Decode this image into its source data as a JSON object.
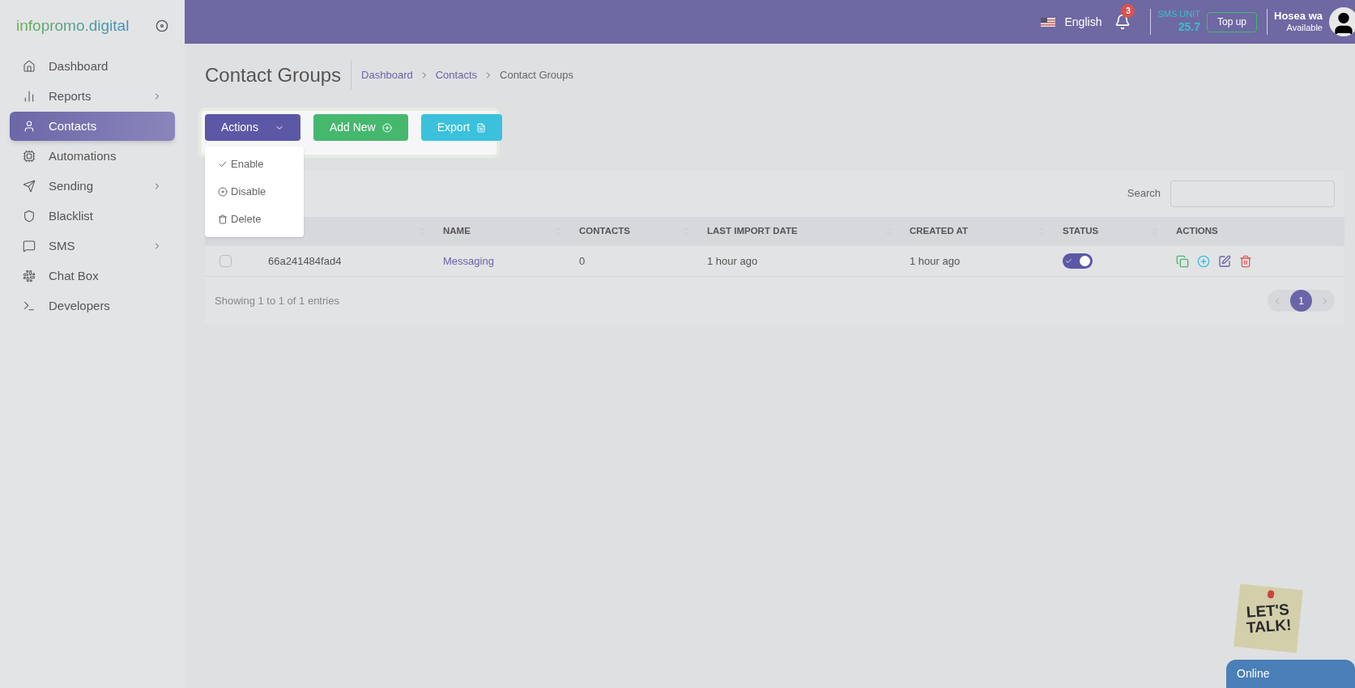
{
  "sidebar": {
    "logo": "infopromo.digital",
    "items": [
      {
        "label": "Dashboard",
        "has_submenu": false,
        "selected": false
      },
      {
        "label": "Reports",
        "has_submenu": true,
        "selected": false
      },
      {
        "label": "Contacts",
        "has_submenu": false,
        "selected": true
      },
      {
        "label": "Automations",
        "has_submenu": false,
        "selected": false
      },
      {
        "label": "Sending",
        "has_submenu": true,
        "selected": false
      },
      {
        "label": "Blacklist",
        "has_submenu": false,
        "selected": false
      },
      {
        "label": "SMS",
        "has_submenu": true,
        "selected": false
      },
      {
        "label": "Chat Box",
        "has_submenu": false,
        "selected": false
      },
      {
        "label": "Developers",
        "has_submenu": false,
        "selected": false
      }
    ]
  },
  "topbar": {
    "language": "English",
    "notification_count": "3",
    "sms_unit_label": "SMS UNIT",
    "sms_unit_value": "25.7",
    "topup": "Top up",
    "user_name": "Hosea wa",
    "user_status": "Available"
  },
  "page": {
    "title": "Contact Groups",
    "breadcrumb": [
      {
        "label": "Dashboard",
        "kind": "link"
      },
      {
        "label": "Contacts",
        "kind": "link"
      },
      {
        "label": "Contact Groups",
        "kind": "current"
      }
    ]
  },
  "toolbar": {
    "buttons": [
      {
        "label": "Actions",
        "kind": "actions"
      },
      {
        "label": "Add New",
        "kind": "add"
      },
      {
        "label": "Export",
        "kind": "export"
      }
    ],
    "dropdown": [
      {
        "label": "Enable",
        "kind": "enable"
      },
      {
        "label": "Disable",
        "kind": "disable"
      },
      {
        "label": "Delete",
        "kind": "delete"
      }
    ]
  },
  "table": {
    "search_label": "Search",
    "columns": [
      {
        "label": "NAME"
      },
      {
        "label": "CONTACTS"
      },
      {
        "label": "LAST IMPORT DATE"
      },
      {
        "label": "CREATED AT"
      },
      {
        "label": "STATUS"
      },
      {
        "label": "ACTIONS"
      }
    ],
    "rows": [
      {
        "checked": false,
        "id": "66a241484fad4",
        "name": "Messaging",
        "contacts": "0",
        "last_import": "1 hour ago",
        "created_at": "1 hour ago",
        "status_on": true
      }
    ],
    "footer": "Showing 1 to 1 of 1 entries",
    "pages": [
      {
        "label": "1",
        "selected": true
      }
    ]
  },
  "chat": {
    "note": "LET'S TALK!",
    "status": "Online"
  }
}
